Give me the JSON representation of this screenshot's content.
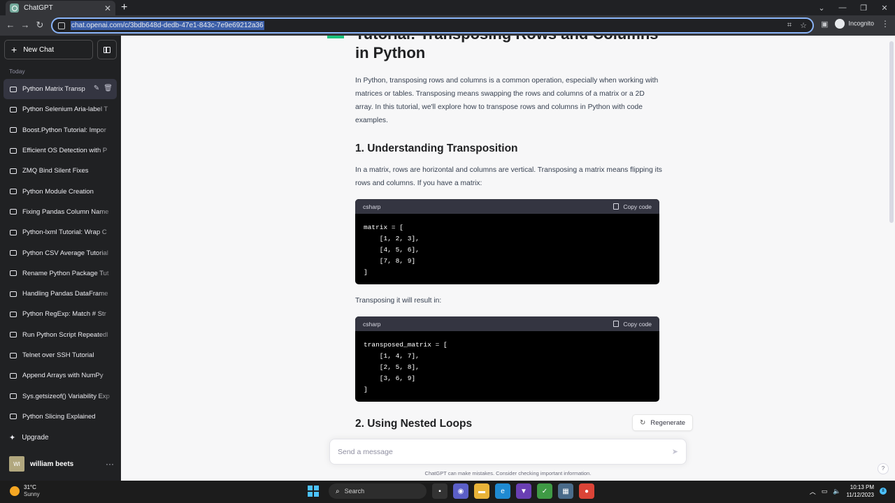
{
  "browser": {
    "tab_title": "ChatGPT",
    "url": "chat.openai.com/c/3bdb648d-dedb-47e1-843c-7e9e69212a36",
    "incognito_label": "Incognito"
  },
  "sidebar": {
    "new_chat_label": "New Chat",
    "section_label": "Today",
    "chats": [
      "Python Matrix Transp",
      "Python Selenium Aria-label T",
      "Boost.Python Tutorial: Impor",
      "Efficient OS Detection with P",
      "ZMQ Bind Silent Fixes",
      "Python Module Creation",
      "Fixing Pandas Column Name",
      "Python-lxml Tutorial: Wrap C",
      "Python CSV Average Tutorial",
      "Rename Python Package Tut",
      "Handling Pandas DataFrame",
      "Python RegExp: Match # Str",
      "Run Python Script Repeatedl",
      "Telnet over SSH Tutorial",
      "Append Arrays with NumPy",
      "Sys.getsizeof() Variability Exp",
      "Python Slicing Explained"
    ],
    "upgrade_label": "Upgrade",
    "user_initials": "WI",
    "user_name": "william beets"
  },
  "content": {
    "title": "Tutorial: Transposing Rows and Columns in Python",
    "intro": "In Python, transposing rows and columns is a common operation, especially when working with matrices or tables. Transposing means swapping the rows and columns of a matrix or a 2D array. In this tutorial, we'll explore how to transpose rows and columns in Python with code examples.",
    "section1_heading": "1. Understanding Transposition",
    "section1_text": "In a matrix, rows are horizontal and columns are vertical. Transposing a matrix means flipping its rows and columns. If you have a matrix:",
    "code1": {
      "lang": "csharp",
      "copy_label": "Copy code",
      "l1": "matrix = [",
      "l2": "    [1, 2, 3],",
      "l3": "    [4, 5, 6],",
      "l4": "    [7, 8, 9]",
      "l5": "]"
    },
    "result_text": "Transposing it will result in:",
    "code2": {
      "lang": "csharp",
      "copy_label": "Copy code",
      "l1": "transposed_matrix = [",
      "l2": "    [1, 4, 7],",
      "l3": "    [2, 5, 8],",
      "l4": "    [3, 6, 9]",
      "l5": "]"
    },
    "section2_heading": "2. Using Nested Loops"
  },
  "composer": {
    "regenerate_label": "Regenerate",
    "placeholder": "Send a message",
    "disclaimer": "ChatGPT can make mistakes. Consider checking important information.",
    "help_label": "?"
  },
  "taskbar": {
    "temperature": "31°C",
    "weather": "Sunny",
    "search_label": "Search",
    "time": "10:13 PM",
    "date": "11/12/2023",
    "notifications": "8"
  }
}
